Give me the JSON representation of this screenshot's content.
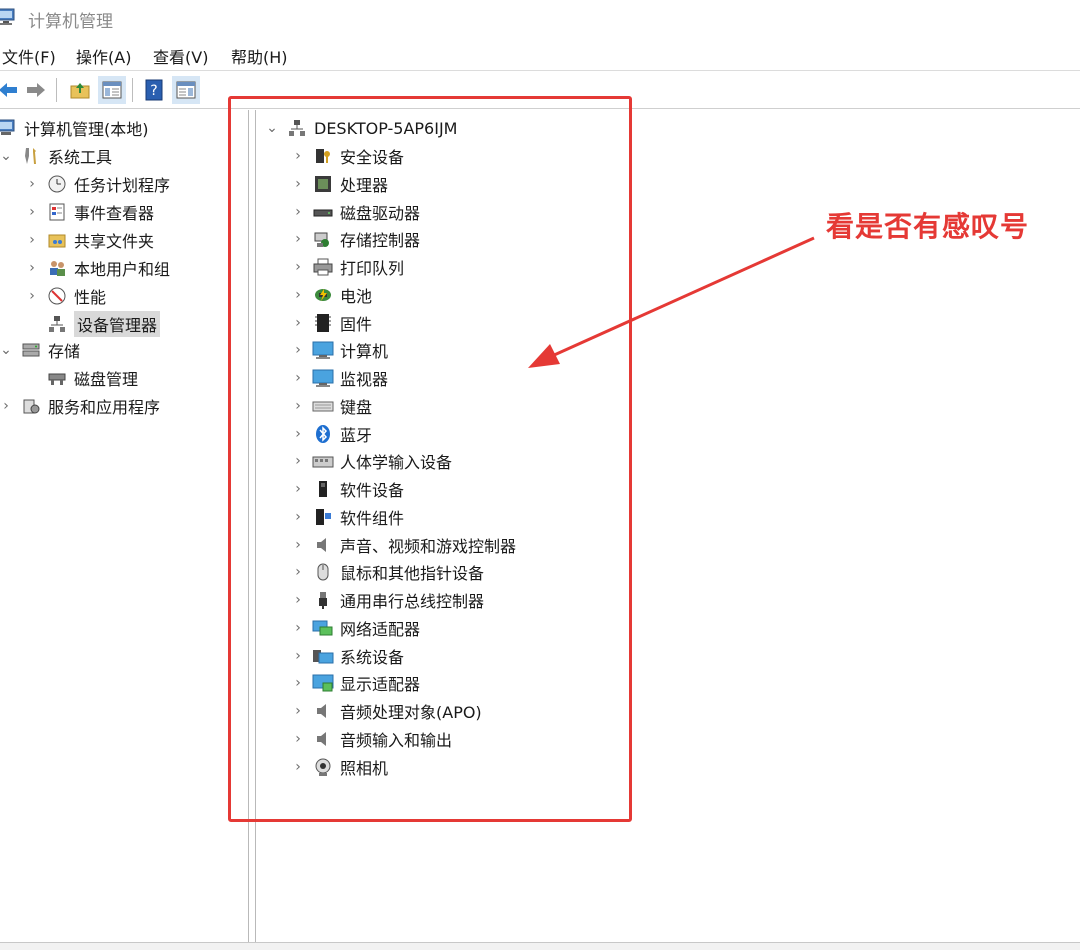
{
  "window": {
    "title": "计算机管理"
  },
  "menu": [
    {
      "label": "文件(F)"
    },
    {
      "label": "操作(A)"
    },
    {
      "label": "查看(V)"
    },
    {
      "label": "帮助(H)"
    }
  ],
  "toolbar": {
    "buttons": [
      "back-icon",
      "forward-icon",
      "up-folder-icon",
      "show-hide-tree-icon",
      "help-icon",
      "properties-pane-icon"
    ]
  },
  "left_tree": {
    "root": "计算机管理(本地)",
    "system_tools": "系统工具",
    "task_scheduler": "任务计划程序",
    "event_viewer": "事件查看器",
    "shared_folders": "共享文件夹",
    "local_users": "本地用户和组",
    "performance": "性能",
    "device_manager": "设备管理器",
    "storage": "存储",
    "disk_management": "磁盘管理",
    "services_apps": "服务和应用程序"
  },
  "device_tree": {
    "computer_name": "DESKTOP-5AP6IJM",
    "categories": [
      {
        "label": "安全设备",
        "icon": "security-device-icon"
      },
      {
        "label": "处理器",
        "icon": "processor-icon"
      },
      {
        "label": "磁盘驱动器",
        "icon": "disk-drive-icon"
      },
      {
        "label": "存储控制器",
        "icon": "storage-controller-icon"
      },
      {
        "label": "打印队列",
        "icon": "printer-icon"
      },
      {
        "label": "电池",
        "icon": "battery-icon"
      },
      {
        "label": "固件",
        "icon": "firmware-icon"
      },
      {
        "label": "计算机",
        "icon": "computer-icon"
      },
      {
        "label": "监视器",
        "icon": "monitor-icon"
      },
      {
        "label": "键盘",
        "icon": "keyboard-icon"
      },
      {
        "label": "蓝牙",
        "icon": "bluetooth-icon"
      },
      {
        "label": "人体学输入设备",
        "icon": "hid-icon"
      },
      {
        "label": "软件设备",
        "icon": "software-device-icon"
      },
      {
        "label": "软件组件",
        "icon": "software-component-icon"
      },
      {
        "label": "声音、视频和游戏控制器",
        "icon": "sound-icon"
      },
      {
        "label": "鼠标和其他指针设备",
        "icon": "mouse-icon"
      },
      {
        "label": "通用串行总线控制器",
        "icon": "usb-icon"
      },
      {
        "label": "网络适配器",
        "icon": "network-adapter-icon"
      },
      {
        "label": "系统设备",
        "icon": "system-device-icon"
      },
      {
        "label": "显示适配器",
        "icon": "display-adapter-icon"
      },
      {
        "label": "音频处理对象(APO)",
        "icon": "speaker-icon"
      },
      {
        "label": "音频输入和输出",
        "icon": "speaker-icon"
      },
      {
        "label": "照相机",
        "icon": "camera-icon"
      }
    ]
  },
  "annotation": {
    "text": "看是否有感叹号",
    "color": "#e53935"
  },
  "colors": {
    "accent_red": "#e53935",
    "selected_bg": "#d9d9d9"
  }
}
